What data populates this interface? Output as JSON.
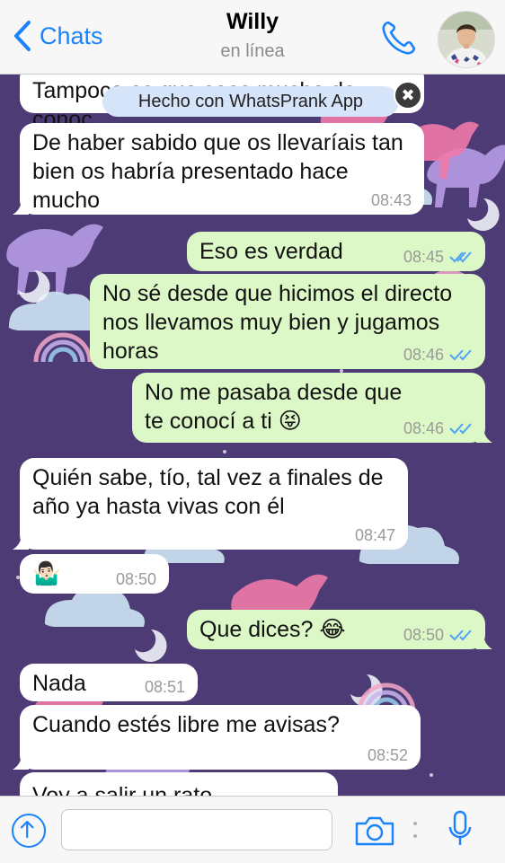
{
  "header": {
    "back_label": "Chats",
    "contact_name": "Willy",
    "status": "en línea"
  },
  "banner": {
    "text": "Hecho con WhatsPrank App",
    "close_glyph": "✖"
  },
  "messages": [
    {
      "direction": "in",
      "text": "Tampoco es que seas mucho de conoc",
      "time": ""
    },
    {
      "direction": "in",
      "text": "De haber sabido que os llevaríais tan bien os habría presentado hace mucho",
      "time": "08:43"
    },
    {
      "direction": "out",
      "text": "Eso es verdad",
      "time": "08:45",
      "status": "read"
    },
    {
      "direction": "out",
      "text": "No sé desde que hicimos el directo nos llevamos muy bien y jugamos horas",
      "time": "08:46",
      "status": "read"
    },
    {
      "direction": "out",
      "text": "No me pasaba desde que te conocí a ti 😝",
      "time": "08:46",
      "status": "read"
    },
    {
      "direction": "in",
      "text": "Quién sabe, tío, tal vez a finales de año ya hasta vivas con él",
      "time": "08:47"
    },
    {
      "direction": "in",
      "text": "🤷🏻‍♂️",
      "time": "08:50"
    },
    {
      "direction": "out",
      "text": "Que dices? 😂",
      "time": "08:50",
      "status": "read"
    },
    {
      "direction": "in",
      "text": "Nada",
      "time": "08:51"
    },
    {
      "direction": "in",
      "text": "Cuando estés libre me avisas?",
      "time": "08:52"
    },
    {
      "direction": "in",
      "text": "Voy a salir un rato",
      "time": ""
    }
  ],
  "composer": {
    "placeholder": ""
  },
  "icons": {
    "back": "chevron-left-icon",
    "call": "phone-icon",
    "attach": "arrow-up-circle-icon",
    "camera": "camera-icon",
    "mic": "microphone-icon"
  },
  "colors": {
    "accent": "#1a82fb",
    "incoming_bubble": "#ffffff",
    "outgoing_bubble": "#dcf8c6",
    "wallpaper": "#4d3b75",
    "read_ticks": "#4fa3f7"
  }
}
